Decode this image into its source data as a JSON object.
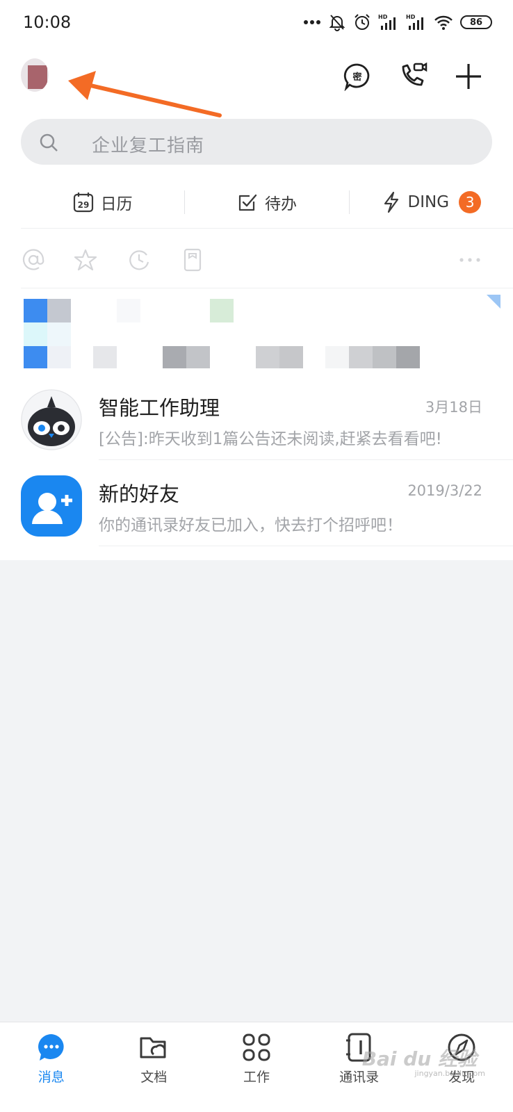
{
  "status_bar": {
    "time": "10:08",
    "battery": "86",
    "icons": [
      "more-dots-icon",
      "mute-bell-icon",
      "alarm-icon",
      "hd-signal-icon",
      "hd-signal-icon",
      "wifi-icon",
      "battery-icon"
    ]
  },
  "header": {
    "icons": [
      "secret-chat-icon",
      "video-call-icon",
      "plus-icon"
    ]
  },
  "search": {
    "placeholder": "企业复工指南"
  },
  "quick_actions": [
    {
      "label": "日历",
      "icon": "calendar-icon",
      "icon_text": "29"
    },
    {
      "label": "待办",
      "icon": "todo-check-icon"
    },
    {
      "label": "DING",
      "icon": "lightning-icon",
      "badge": "3"
    }
  ],
  "filters": [
    "at-icon",
    "star-icon",
    "clock-icon",
    "bookmark-icon",
    "more-icon"
  ],
  "conversations": [
    {
      "name": "智能工作助理",
      "time": "3月18日",
      "preview": "[公告]:昨天收到1篇公告还未阅读,赶紧去看看吧!"
    },
    {
      "name": "新的好友",
      "time": "2019/3/22",
      "preview": "你的通讯录好友已加入，快去打个招呼吧！"
    }
  ],
  "tabs": [
    {
      "label": "消息",
      "icon": "message-icon",
      "active": true
    },
    {
      "label": "文档",
      "icon": "folder-icon",
      "active": false
    },
    {
      "label": "工作",
      "icon": "grid-icon",
      "active": false
    },
    {
      "label": "通讯录",
      "icon": "contacts-icon",
      "active": false
    },
    {
      "label": "发现",
      "icon": "compass-icon",
      "active": false
    }
  ],
  "watermark": {
    "text": "Bai du 经验",
    "sub": "jingyan.baidu.com"
  },
  "colors": {
    "accent": "#1a87f0",
    "badge": "#f36b25",
    "arrow": "#f36b25"
  }
}
